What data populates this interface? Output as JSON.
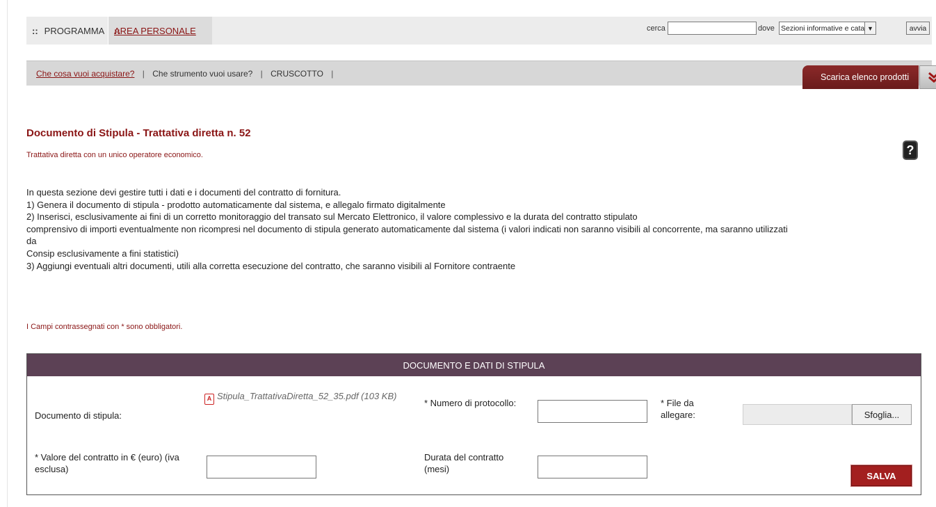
{
  "nav": {
    "tabs": [
      {
        "label": "PROGRAMMA",
        "bullet": "::"
      },
      {
        "label": "AREA PERSONALE",
        "bullet": "::"
      }
    ],
    "search": {
      "cerca_label": "cerca",
      "query": "",
      "dove_label": "dove",
      "scope_selected": "Sezioni informative e catalogo",
      "go_label": "avvia"
    }
  },
  "subnav": {
    "links": [
      "Che cosa vuoi acquistare?",
      "Che strumento vuoi usare?",
      "CRUSCOTTO"
    ],
    "separator": "|",
    "download_label": "Scarica elenco prodotti",
    "chevron_glyph": "❯"
  },
  "page": {
    "title": "Documento di Stipula - Trattativa diretta n. 52",
    "subtitle": "Trattativa diretta con un unico operatore economico.",
    "help_glyph": "?",
    "instructions": [
      "In questa sezione devi gestire tutti i dati e i documenti del contratto di fornitura.",
      "1) Genera il documento di stipula - prodotto automaticamente dal sistema, e allegalo firmato digitalmente",
      "2) Inserisci, esclusivamente ai fini di un corretto monitoraggio del transato sul Mercato Elettronico, il valore complessivo e la durata del contratto stipulato",
      "comprensivo di importi eventualmente non ricompresi nel documento di stipula generato automaticamente dal sistema (i valori indicati non saranno visibili al concorrente, ma saranno utilizzati",
      "da",
      "Consip esclusivamente a fini statistici)",
      "3) Aggiungi eventuali altri documenti, utili alla corretta esecuzione del contratto, che saranno visibili al Fornitore contraente"
    ],
    "required_note": "I Campi contrassegnati con * sono obbligatori."
  },
  "form": {
    "header": "DOCUMENTO E DATI DI STIPULA",
    "documento_label": "Documento di stipula:",
    "file_name": "Stipula_TrattativaDiretta_52_35.pdf (103 KB)",
    "pdf_icon": "pdf-icon",
    "numero_protocollo_label": "* Numero di protocollo:",
    "numero_protocollo_value": "",
    "file_allegare_label": "* File da allegare:",
    "browse_label": "Sfoglia...",
    "valore_label": "* Valore del contratto in € (euro) (iva esclusa)",
    "valore_value": "",
    "durata_label": "Durata del contratto (mesi)",
    "durata_value": "",
    "save_label": "SALVA"
  },
  "colors": {
    "accent": "#8a1515",
    "header_bg": "#5c4155",
    "save_button": "#a31f1f",
    "nav_bg": "#ececec",
    "subnav_bg": "#d7d7d7"
  }
}
